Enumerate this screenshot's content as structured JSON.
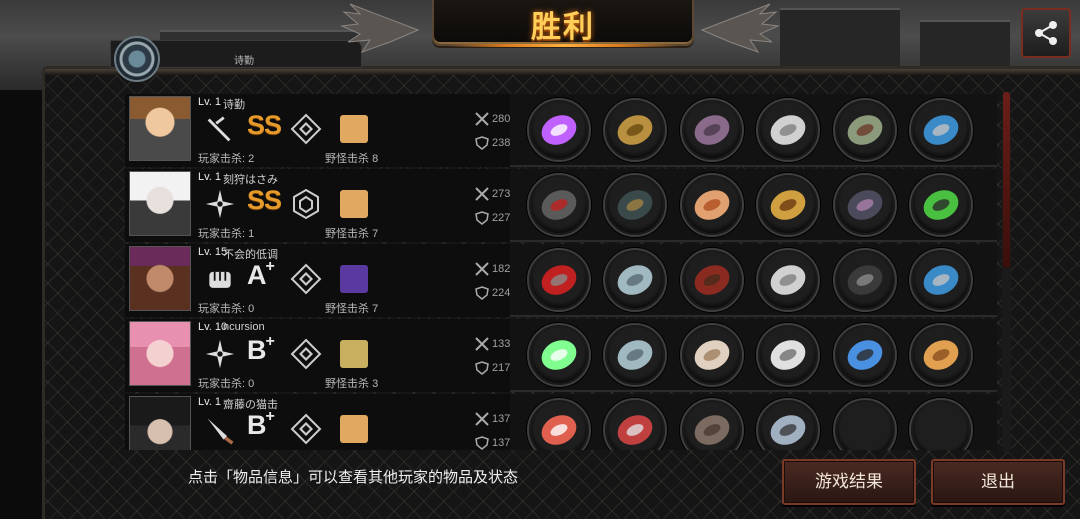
{
  "header": {
    "title": "胜利",
    "self_player_name": "诗勤"
  },
  "hint_text": "点击「物品信息」可以查看其他玩家的物品及状态",
  "buttons": {
    "results": "游戏结果",
    "exit": "退出"
  },
  "labels": {
    "player_kills": "玩家击杀",
    "monster_kills": "野怪击杀"
  },
  "colors": {
    "accent_gold": "#e69a2a",
    "button_border": "#7a3a28",
    "scroll_thumb": "#6b1e18"
  },
  "players": [
    {
      "level": "Lv. 1",
      "name": "诗勤",
      "weapon": "tonfa-icon",
      "rank": "SS",
      "rank_plus": "",
      "rank_gold": true,
      "player_kills": "2",
      "monster_kills": "8",
      "attack": "280",
      "defense": "238",
      "items": [
        "lightsaber-icon",
        "golden-helmet-icon",
        "purple-armor-icon",
        "silver-bracer-icon",
        "chain-gauntlet-icon",
        "pendant-icon"
      ]
    },
    {
      "level": "Lv. 1",
      "name": "刻狩はさみ",
      "weapon": "shuriken-icon",
      "rank": "SS",
      "rank_plus": "",
      "rank_gold": true,
      "player_kills": "1",
      "monster_kills": "7",
      "attack": "273",
      "defense": "227",
      "items": [
        "dark-blade-icon",
        "dark-helmet-icon",
        "ice-cream-icon",
        "golden-shield-icon",
        "dark-gauntlet-icon",
        "green-orb-icon"
      ]
    },
    {
      "level": "Lv. 15",
      "name": "不会的低调",
      "weapon": "fist-icon",
      "rank": "A",
      "rank_plus": "+",
      "rank_gold": false,
      "player_kills": "0",
      "monster_kills": "7",
      "attack": "182",
      "defense": "224",
      "items": [
        "red-gauntlet-icon",
        "silver-helmet-icon",
        "red-armor-icon",
        "silver-bracer-icon",
        "black-boots-icon",
        "pendant-icon"
      ]
    },
    {
      "level": "Lv. 10",
      "name": "ncursion",
      "weapon": "shuriken-icon",
      "rank": "B",
      "rank_plus": "+",
      "rank_gold": false,
      "player_kills": "0",
      "monster_kills": "3",
      "attack": "133",
      "defense": "217",
      "items": [
        "twin-sabers-icon",
        "silver-helmet-icon",
        "white-armor-icon",
        "metal-disc-icon",
        "blue-boots-icon",
        "fan-icon"
      ]
    },
    {
      "level": "Lv. 1",
      "name": "齋藤の猫击",
      "weapon": "knife-icon",
      "rank": "B",
      "rank_plus": "+",
      "rank_gold": false,
      "player_kills": "",
      "monster_kills": "",
      "attack": "137",
      "defense": "137",
      "items": [
        "spiked-mace-icon",
        "crossbow-icon",
        "leather-armor-icon",
        "wristwatch-icon",
        "empty-slot",
        "empty-slot"
      ]
    }
  ]
}
